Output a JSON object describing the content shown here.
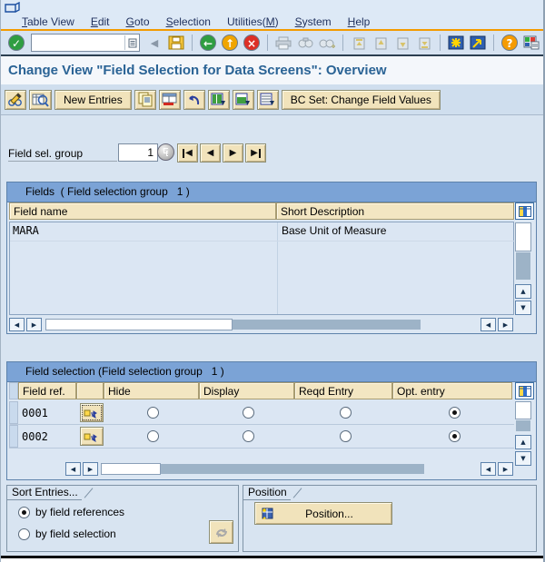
{
  "title": "Change View \"Field Selection for Data Screens\": Overview",
  "menubar": {
    "items": [
      {
        "pre": "",
        "key": "T",
        "post": "able View"
      },
      {
        "pre": "",
        "key": "E",
        "post": "dit"
      },
      {
        "pre": "",
        "key": "G",
        "post": "oto"
      },
      {
        "pre": "",
        "key": "S",
        "post": "election"
      },
      {
        "pre": "Utilities(",
        "key": "M",
        "post": ")"
      },
      {
        "pre": "",
        "key": "S",
        "post": "ystem"
      },
      {
        "pre": "",
        "key": "H",
        "post": "elp"
      }
    ]
  },
  "glyphs": {
    "check": "✓",
    "left": "◀",
    "right": "▶",
    "up": "▲",
    "down": "▼",
    "back_arrow": "←",
    "up_arrow": "↑",
    "cancel": "×",
    "help": "?"
  },
  "command_field": {
    "value": "",
    "placeholder": ""
  },
  "app_toolbar": {
    "new_entries": "New Entries",
    "bc_set": "BC Set: Change Field Values"
  },
  "field_sel_group": {
    "label": "Field sel. group",
    "value": "1"
  },
  "fields_panel": {
    "title": "Fields  ( Field selection group   1 )",
    "columns": [
      "Field name",
      "Short Description"
    ],
    "rows": [
      {
        "name": "MARA",
        "desc": "Base Unit of Measure"
      }
    ]
  },
  "selection_panel": {
    "title": "Field selection (Field selection group   1 )",
    "columns": [
      "Field ref.",
      "",
      "Hide",
      "Display",
      "Reqd Entry",
      "Opt. entry"
    ],
    "rows": [
      {
        "ref": "0001",
        "selected": "Opt. entry"
      },
      {
        "ref": "0002",
        "selected": "Opt. entry"
      }
    ]
  },
  "sort_group": {
    "title": "Sort Entries...",
    "options": [
      {
        "label": "by field references",
        "selected": true
      },
      {
        "label": "by field selection",
        "selected": false
      }
    ]
  },
  "position_group": {
    "title": "Position",
    "button": "Position..."
  },
  "colors": {
    "accent_orange": "#f39b00",
    "panel_header_blue": "#7ba3d6",
    "button_tan": "#f1e3bb",
    "title_blue": "#2a6395",
    "content_bg": "#d8e4f1"
  }
}
